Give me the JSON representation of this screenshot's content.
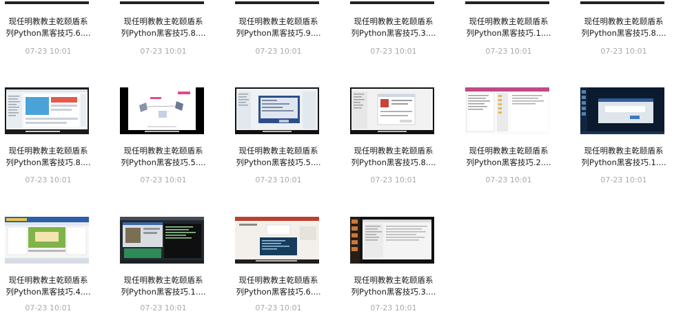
{
  "files": [
    {
      "line1": "现任明教教主乾颐盾系",
      "line2": "列Python黑客技巧.6....",
      "date": "07-23 10:01"
    },
    {
      "line1": "现任明教教主乾颐盾系",
      "line2": "列Python黑客技巧.8....",
      "date": "07-23 10:01"
    },
    {
      "line1": "现任明教教主乾颐盾系",
      "line2": "列Python黑客技巧.9....",
      "date": "07-23 10:01"
    },
    {
      "line1": "现任明教教主乾颐盾系",
      "line2": "列Python黑客技巧.3....",
      "date": "07-23 10:01"
    },
    {
      "line1": "现任明教教主乾颐盾系",
      "line2": "列Python黑客技巧.1....",
      "date": "07-23 10:01"
    },
    {
      "line1": "现任明教教主乾颐盾系",
      "line2": "列Python黑客技巧.8....",
      "date": "07-23 10:01"
    },
    {
      "line1": "现任明教教主乾颐盾系",
      "line2": "列Python黑客技巧.8....",
      "date": "07-23 10:01"
    },
    {
      "line1": "现任明教教主乾颐盾系",
      "line2": "列Python黑客技巧.5....",
      "date": "07-23 10:01"
    },
    {
      "line1": "现任明教教主乾颐盾系",
      "line2": "列Python黑客技巧.5....",
      "date": "07-23 10:01"
    },
    {
      "line1": "现任明教教主乾颐盾系",
      "line2": "列Python黑客技巧.8....",
      "date": "07-23 10:01"
    },
    {
      "line1": "现任明教教主乾颐盾系",
      "line2": "列Python黑客技巧.2....",
      "date": "07-23 10:01"
    },
    {
      "line1": "现任明教教主乾颐盾系",
      "line2": "列Python黑客技巧.1....",
      "date": "07-23 10:01"
    },
    {
      "line1": "现任明教教主乾颐盾系",
      "line2": "列Python黑客技巧.4....",
      "date": "07-23 10:01"
    },
    {
      "line1": "现任明教教主乾颐盾系",
      "line2": "列Python黑客技巧.1....",
      "date": "07-23 10:01"
    },
    {
      "line1": "现任明教教主乾颐盾系",
      "line2": "列Python黑客技巧.6....",
      "date": "07-23 10:01"
    },
    {
      "line1": "现任明教教主乾颐盾系",
      "line2": "列Python黑客技巧.3....",
      "date": "07-23 10:01"
    }
  ]
}
